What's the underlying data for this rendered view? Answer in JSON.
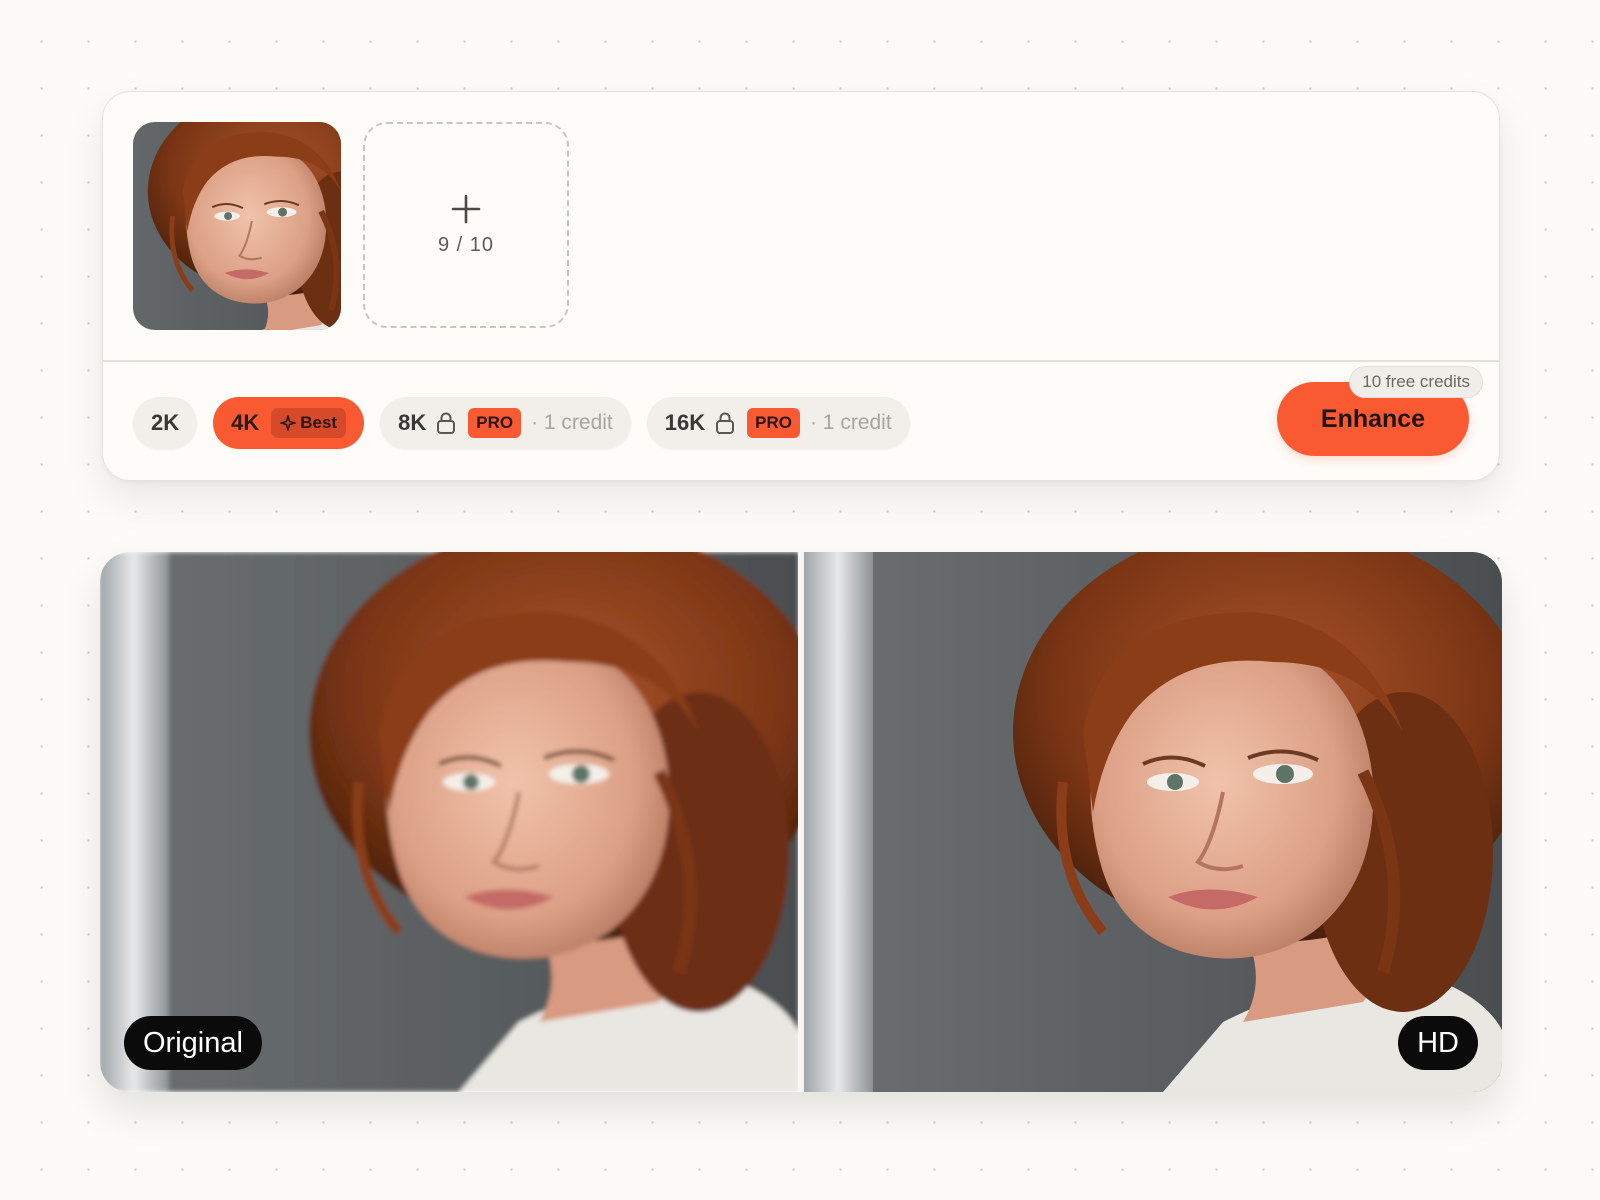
{
  "uploader": {
    "slot_count": "9 / 10"
  },
  "resolution_options": [
    {
      "label": "2K",
      "selected": false
    },
    {
      "label": "4K",
      "badge": "Best",
      "selected": true
    },
    {
      "label": "8K",
      "badge": "PRO",
      "locked": true,
      "credit": "· 1 credit"
    },
    {
      "label": "16K",
      "badge": "PRO",
      "locked": true,
      "credit": "· 1 credit"
    }
  ],
  "enhance": {
    "label": "Enhance",
    "credits_badge": "10 free credits"
  },
  "comparison": {
    "left_label": "Original",
    "right_label": "HD"
  },
  "colors": {
    "accent": "#fa5a32",
    "background": "#fcfbf8",
    "pill_dark": "#0b0b0b"
  },
  "icons": [
    "plus-icon",
    "sparkle-icon",
    "lock-icon"
  ]
}
